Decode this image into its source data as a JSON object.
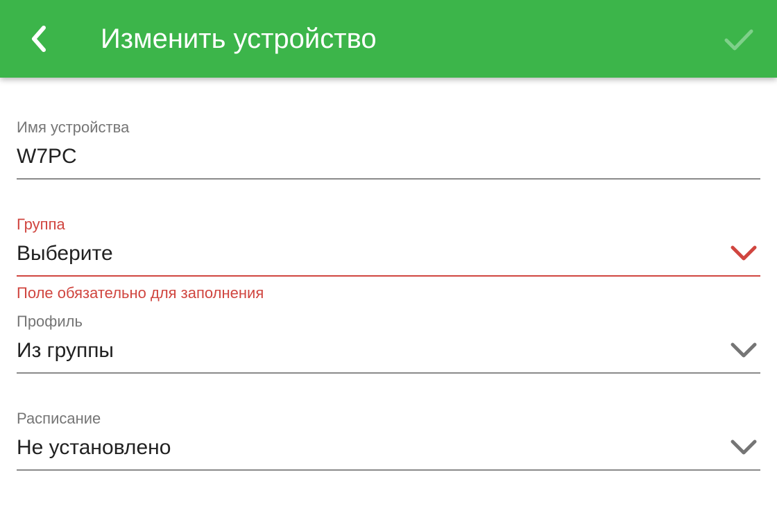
{
  "header": {
    "title": "Изменить устройство",
    "back_icon": "chevron-left-icon",
    "confirm_icon": "check-icon",
    "background_color": "#3cb54a"
  },
  "form": {
    "device_name": {
      "label": "Имя устройства",
      "value": "W7PC"
    },
    "group": {
      "label": "Группа",
      "value": "Выберите",
      "error": "Поле обязательно для заполнения",
      "error_color": "#d0453f"
    },
    "profile": {
      "label": "Профиль",
      "value": "Из группы"
    },
    "schedule": {
      "label": "Расписание",
      "value": "Не установлено"
    }
  }
}
